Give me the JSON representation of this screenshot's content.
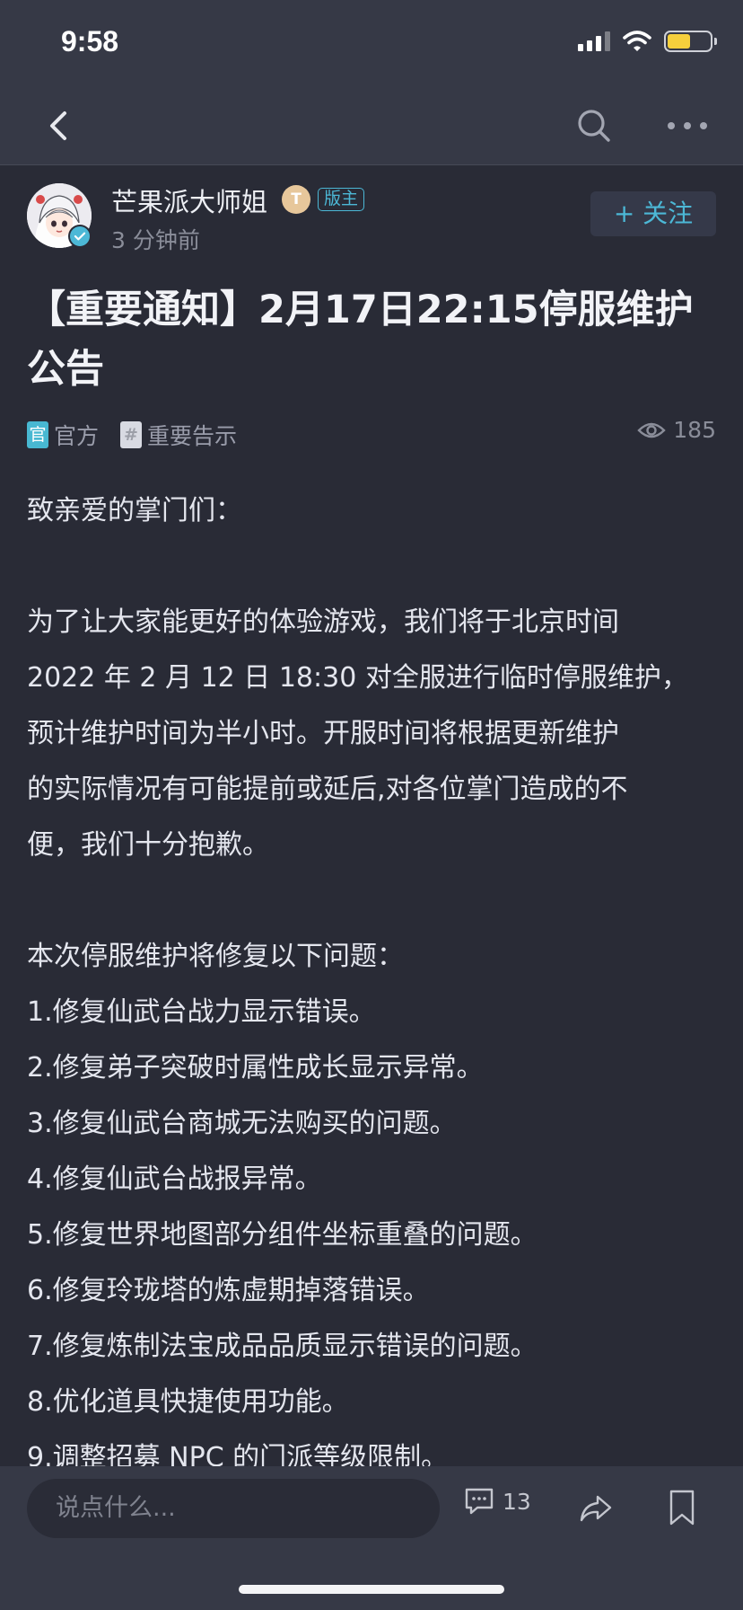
{
  "status_bar": {
    "time": "9:58"
  },
  "nav": {
    "back_icon": "chevron-left-icon",
    "search_icon": "search-icon",
    "more_icon": "more-dots-icon"
  },
  "author": {
    "name": "芒果派大师姐",
    "level_badge": "T",
    "role_badge": "版主",
    "post_time": "3 分钟前",
    "follow_label": "+ 关注"
  },
  "post": {
    "title": "【重要通知】2月17日22:15停服维护公告",
    "tags": [
      {
        "icon_text": "官",
        "label": "官方"
      },
      {
        "icon_text": "#",
        "label": "重要告示"
      }
    ],
    "views": "185",
    "lines": [
      "致亲爱的掌门们：",
      "",
      "为了让大家能更好的体验游戏，我们将于北京时间",
      "2022 年 2 月 12 日 18:30 对全服进行临时停服维护，",
      "预计维护时间为半小时。开服时间将根据更新维护",
      "的实际情况有可能提前或延后,对各位掌门造成的不",
      "便，我们十分抱歉。",
      "",
      "本次停服维护将修复以下问题：",
      "1.修复仙武台战力显示错误。",
      "2.修复弟子突破时属性成长显示异常。",
      "3.修复仙武台商城无法购买的问题。",
      "4.修复仙武台战报异常。",
      "5.修复世界地图部分组件坐标重叠的问题。",
      "6.修复玲珑塔的炼虚期掉落错误。",
      "7.修复炼制法宝成品品质显示错误的问题。",
      "8.优化道具快捷使用功能。",
      "9.调整招募 NPC 的门派等级限制。"
    ]
  },
  "bottom_bar": {
    "comment_placeholder": "说点什么...",
    "comment_count": "13",
    "share_icon": "share-icon",
    "bookmark_icon": "bookmark-icon"
  },
  "colors": {
    "accent": "#4cb8d6",
    "background": "#292b36",
    "bar": "#363946"
  }
}
